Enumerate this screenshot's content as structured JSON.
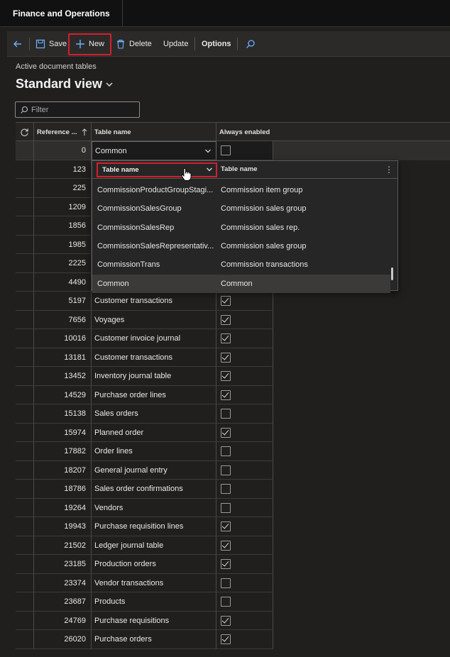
{
  "app": {
    "title": "Finance and Operations"
  },
  "actionpane": {
    "save": "Save",
    "new": "New",
    "delete": "Delete",
    "update": "Update",
    "options": "Options"
  },
  "page": {
    "caption": "Active document tables",
    "view_name": "Standard view",
    "filter_placeholder": "Filter"
  },
  "grid": {
    "columns": [
      "Reference ...",
      "Table name",
      "Always enabled"
    ],
    "rows": [
      {
        "ref": "0",
        "name": "Common",
        "checked": false
      },
      {
        "ref": "123",
        "name": "",
        "checked": false
      },
      {
        "ref": "225",
        "name": "",
        "checked": false
      },
      {
        "ref": "1209",
        "name": "",
        "checked": false
      },
      {
        "ref": "1856",
        "name": "",
        "checked": false
      },
      {
        "ref": "1985",
        "name": "",
        "checked": false
      },
      {
        "ref": "2225",
        "name": "",
        "checked": false
      },
      {
        "ref": "4490",
        "name": "",
        "checked": false
      },
      {
        "ref": "5197",
        "name": "Customer transactions",
        "checked": true
      },
      {
        "ref": "7656",
        "name": "Voyages",
        "checked": true
      },
      {
        "ref": "10016",
        "name": "Customer invoice journal",
        "checked": true
      },
      {
        "ref": "13181",
        "name": "Customer transactions",
        "checked": true
      },
      {
        "ref": "13452",
        "name": "Inventory journal table",
        "checked": true
      },
      {
        "ref": "14529",
        "name": "Purchase order lines",
        "checked": true
      },
      {
        "ref": "15138",
        "name": "Sales orders",
        "checked": false
      },
      {
        "ref": "15974",
        "name": "Planned order",
        "checked": true
      },
      {
        "ref": "17882",
        "name": "Order lines",
        "checked": false
      },
      {
        "ref": "18207",
        "name": "General journal entry",
        "checked": false
      },
      {
        "ref": "18786",
        "name": "Sales order confirmations",
        "checked": false
      },
      {
        "ref": "19264",
        "name": "Vendors",
        "checked": false
      },
      {
        "ref": "19943",
        "name": "Purchase requisition lines",
        "checked": true
      },
      {
        "ref": "21502",
        "name": "Ledger journal table",
        "checked": true
      },
      {
        "ref": "23185",
        "name": "Production orders",
        "checked": true
      },
      {
        "ref": "23374",
        "name": "Vendor transactions",
        "checked": false
      },
      {
        "ref": "23687",
        "name": "Products",
        "checked": false
      },
      {
        "ref": "24769",
        "name": "Purchase requisitions",
        "checked": true
      },
      {
        "ref": "26020",
        "name": "Purchase orders",
        "checked": true
      }
    ]
  },
  "dropdown": {
    "col1": "Table name",
    "col2": "Table name",
    "items": [
      {
        "name": "CommissionProductGroupStagi...",
        "label": "Commission item group"
      },
      {
        "name": "CommissionSalesGroup",
        "label": "Commission sales group"
      },
      {
        "name": "CommissionSalesRep",
        "label": "Commission sales rep."
      },
      {
        "name": "CommissionSalesRepresentativ...",
        "label": "Commission sales group"
      },
      {
        "name": "CommissionTrans",
        "label": "Commission transactions"
      },
      {
        "name": "Common",
        "label": "Common"
      }
    ]
  }
}
